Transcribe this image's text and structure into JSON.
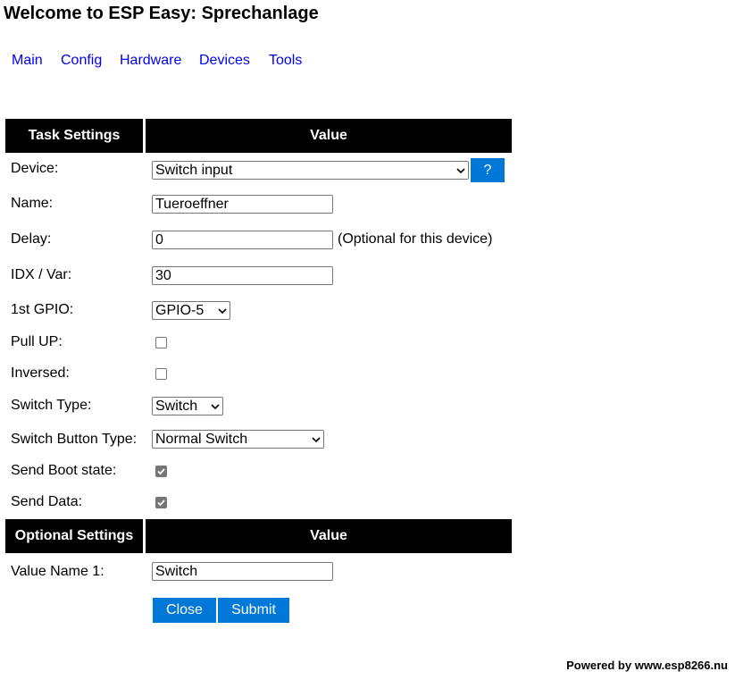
{
  "page": {
    "title": "Welcome to ESP Easy: Sprechanlage"
  },
  "nav": {
    "main": "Main",
    "config": "Config",
    "hardware": "Hardware",
    "devices": "Devices",
    "tools": "Tools"
  },
  "task_table": {
    "header_left": "Task Settings",
    "header_right": "Value",
    "device_label": "Device:",
    "device_value": "Switch input",
    "help_label": "?",
    "name_label": "Name:",
    "name_value": "Tueroeffner",
    "delay_label": "Delay:",
    "delay_value": "0",
    "delay_note": "(Optional for this device)",
    "idx_label": "IDX / Var:",
    "idx_value": "30",
    "gpio_label": "1st GPIO:",
    "gpio_value": "GPIO-5",
    "pullup_label": "Pull UP:",
    "pullup_checked": false,
    "inversed_label": "Inversed:",
    "inversed_checked": false,
    "switch_type_label": "Switch Type:",
    "switch_type_value": "Switch",
    "switch_button_type_label": "Switch Button Type:",
    "switch_button_type_value": "Normal Switch",
    "send_boot_label": "Send Boot state:",
    "send_boot_checked": true,
    "send_data_label": "Send Data:",
    "send_data_checked": true
  },
  "optional_table": {
    "header_left": "Optional Settings",
    "header_right": "Value",
    "value_name_label": "Value Name 1:",
    "value_name_value": "Switch"
  },
  "buttons": {
    "close": "Close",
    "submit": "Submit"
  },
  "footer": {
    "text": "Powered by www.esp8266.nu"
  },
  "colors": {
    "link": "#0000ee",
    "button": "#0078d7",
    "header_bg": "#000000",
    "checkbox_checked": "#767676"
  }
}
